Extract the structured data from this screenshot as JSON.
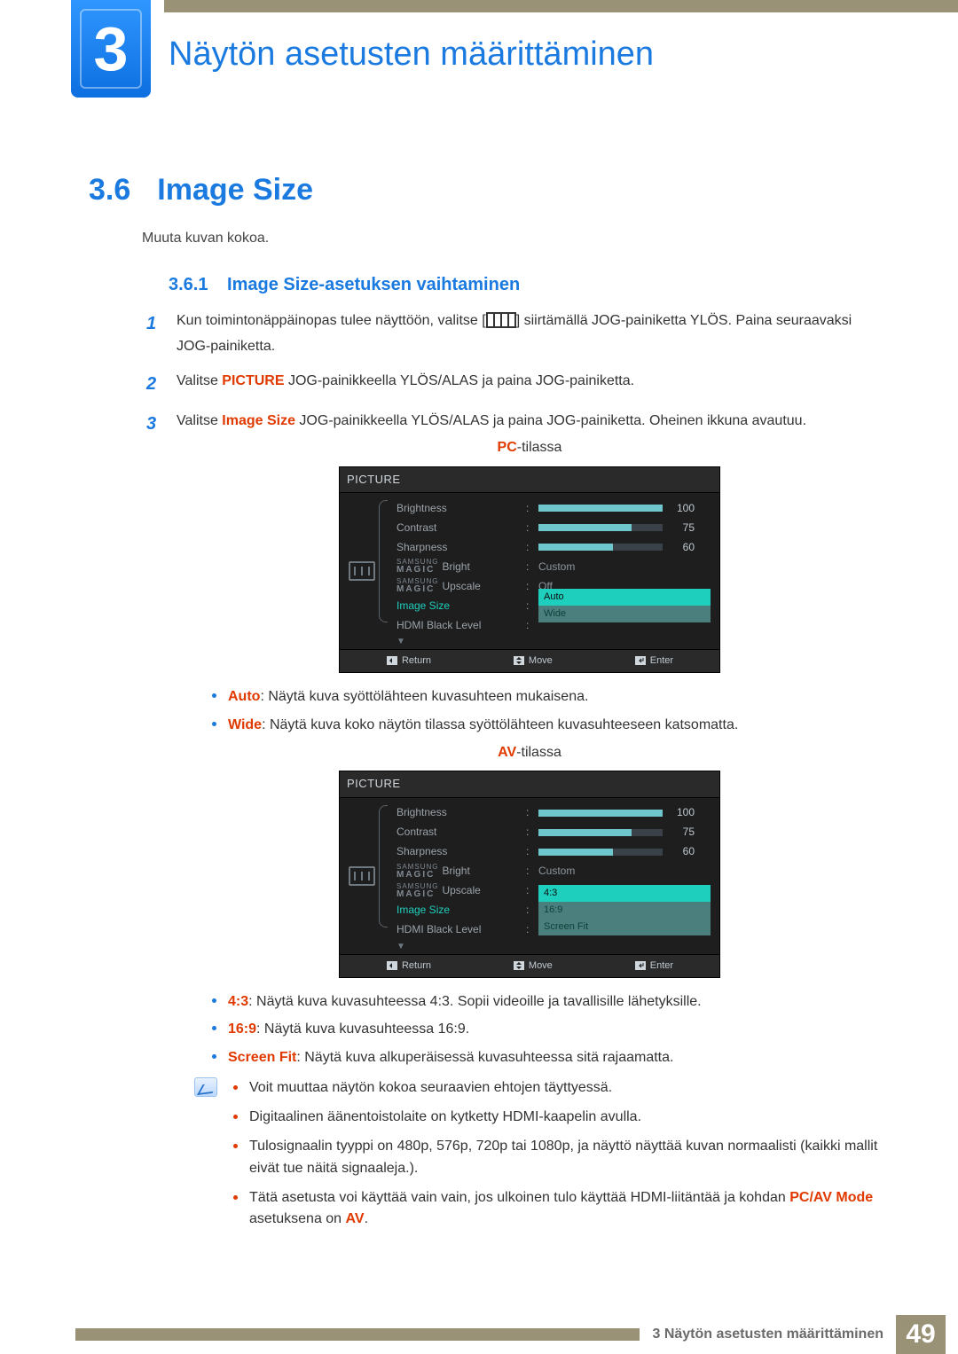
{
  "chapter": {
    "number": "3",
    "title": "Näytön asetusten määrittäminen"
  },
  "section": {
    "number": "3.6",
    "title": "Image Size",
    "intro": "Muuta kuvan kokoa."
  },
  "subsection": {
    "number": "3.6.1",
    "title": "Image Size-asetuksen vaihtaminen"
  },
  "steps": [
    {
      "n": "1",
      "pre": "Kun toimintonäppäinopas tulee näyttöön, valitse [",
      "post": "] siirtämällä JOG-painiketta YLÖS. Paina seuraavaksi JOG-painiketta."
    },
    {
      "n": "2",
      "pre": "Valitse ",
      "term": "PICTURE",
      "post": " JOG-painikkeella YLÖS/ALAS ja paina JOG-painiketta."
    },
    {
      "n": "3",
      "pre": "Valitse ",
      "term": "Image Size",
      "post": " JOG-painikkeella YLÖS/ALAS ja paina JOG-painiketta. Oheinen ikkuna avautuu."
    }
  ],
  "modes": {
    "pc_label_prefix": "PC",
    "pc_label_suffix": "-tilassa",
    "av_label_prefix": "AV",
    "av_label_suffix": "-tilassa"
  },
  "osd_common": {
    "title": "PICTURE",
    "rows": {
      "brightness": {
        "label": "Brightness",
        "value": 100,
        "max": 100
      },
      "contrast": {
        "label": "Contrast",
        "value": 75,
        "max": 100
      },
      "sharpness": {
        "label": "Sharpness",
        "value": 60,
        "max": 100
      },
      "magic_bright": {
        "brand_top": "SAMSUNG",
        "brand_bottom": "MAGIC",
        "suffix": "Bright",
        "value": "Custom"
      },
      "magic_upscale": {
        "brand_top": "SAMSUNG",
        "brand_bottom": "MAGIC",
        "suffix": "Upscale",
        "value": "Off"
      },
      "image_size": {
        "label": "Image Size"
      },
      "hdmi_black": {
        "label": "HDMI Black Level"
      }
    },
    "footer": {
      "return": "Return",
      "move": "Move",
      "enter": "Enter"
    }
  },
  "pc_options": {
    "selected": "Auto",
    "other": "Wide"
  },
  "av_options": {
    "selected": "4:3",
    "mid": "16:9",
    "other": "Screen Fit"
  },
  "pc_bullets": [
    {
      "term": "Auto",
      "text": ": Näytä kuva syöttölähteen kuvasuhteen mukaisena."
    },
    {
      "term": "Wide",
      "text": ": Näytä kuva koko näytön tilassa syöttölähteen kuvasuhteeseen katsomatta."
    }
  ],
  "av_bullets": [
    {
      "term": "4:3",
      "text": ": Näytä kuva kuvasuhteessa 4:3. Sopii videoille ja tavallisille lähetyksille."
    },
    {
      "term": "16:9",
      "text": ": Näytä kuva kuvasuhteessa 16:9."
    },
    {
      "term": "Screen Fit",
      "text": ": Näytä kuva alkuperäisessä kuvasuhteessa sitä rajaamatta."
    }
  ],
  "note": [
    {
      "text": "Voit muuttaa näytön kokoa seuraavien ehtojen täyttyessä."
    },
    {
      "text": "Digitaalinen äänentoistolaite on kytketty HDMI-kaapelin avulla."
    },
    {
      "text": "Tulosignaalin tyyppi on 480p, 576p, 720p tai 1080p, ja näyttö näyttää kuvan normaalisti (kaikki mallit eivät tue näitä signaaleja.)."
    },
    {
      "text_pre": "Tätä asetusta voi käyttää vain vain, jos ulkoinen tulo käyttää HDMI-liitäntää ja kohdan ",
      "term1": "PC/AV Mode",
      "mid": " asetuksena on ",
      "term2": "AV",
      "tail": "."
    }
  ],
  "footer": {
    "text": "3 Näytön asetusten määrittäminen",
    "page": "49"
  }
}
